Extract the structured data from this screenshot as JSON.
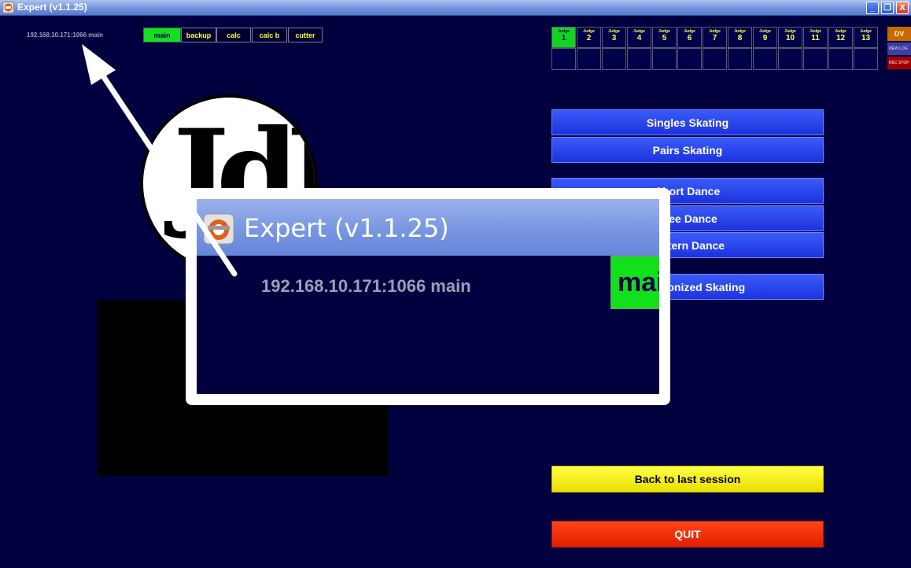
{
  "window": {
    "title": "Expert (v1.1.25)",
    "minimize": "_",
    "maximize": "❐",
    "close": "X"
  },
  "server": {
    "line": "192.168.10.171:1066 main"
  },
  "modes": [
    {
      "label": "main",
      "active": true
    },
    {
      "label": "backup",
      "active": false
    },
    {
      "label": "calc",
      "active": false
    },
    {
      "label": "calc b",
      "active": false
    },
    {
      "label": "cutter",
      "active": false
    }
  ],
  "judges": {
    "label": "Judge",
    "numbers": [
      "1",
      "2",
      "3",
      "4",
      "5",
      "6",
      "7",
      "8",
      "9",
      "10",
      "11",
      "12",
      "13"
    ],
    "active": "1"
  },
  "side_buttons": {
    "dv": "DV",
    "new_log": "NEW LOG",
    "rec_stop": "REC STOP"
  },
  "logo_text": "JdJ",
  "menu": {
    "singles": "Singles Skating",
    "pairs": "Pairs Skating",
    "short_dance": "Short Dance",
    "free_dance": "Free Dance",
    "pattern_dance": "Pattern Dance",
    "synchronized": "Synchronized Skating",
    "back": "Back to last session",
    "quit": "QUIT"
  },
  "zoom_callout": {
    "title": "Expert (v1.1.25)",
    "server": "192.168.10.171:1066 main",
    "main_button": "main"
  },
  "colors": {
    "background": "#00003f",
    "active_green": "#12e01c",
    "menu_blue": "#2a48f0",
    "back_yellow": "#ffff22",
    "quit_red": "#f03008"
  }
}
